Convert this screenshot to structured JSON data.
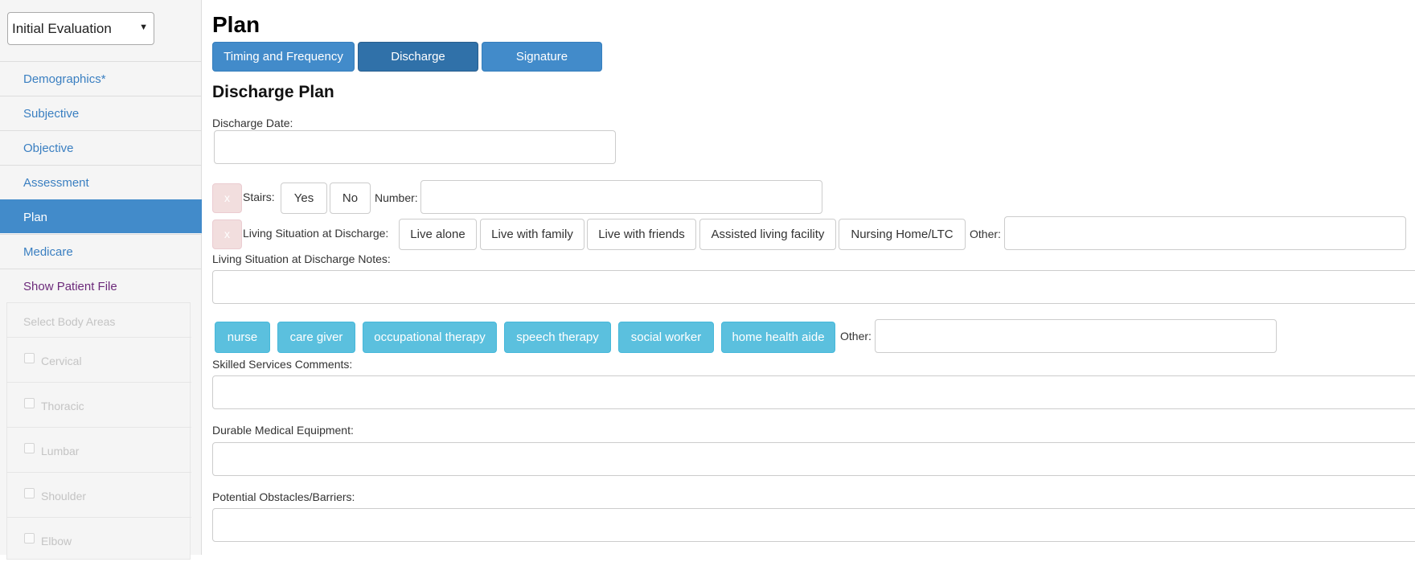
{
  "sidebar": {
    "evaluation_select": "Initial Evaluation",
    "nav": [
      {
        "label": "Demographics*"
      },
      {
        "label": "Subjective"
      },
      {
        "label": "Objective"
      },
      {
        "label": "Assessment"
      },
      {
        "label": "Plan",
        "active": true
      },
      {
        "label": "Medicare"
      },
      {
        "label": "Show Patient File"
      }
    ],
    "body_areas": {
      "header": "Select Body Areas",
      "items": [
        "Cervical",
        "Thoracic",
        "Lumbar",
        "Shoulder",
        "Elbow"
      ]
    }
  },
  "main": {
    "title": "Plan",
    "tabs": [
      {
        "label": "Timing and Frequency"
      },
      {
        "label": "Discharge",
        "active": true
      },
      {
        "label": "Signature"
      }
    ],
    "section_title": "Discharge Plan",
    "discharge_date_label": "Discharge Date:",
    "stairs": {
      "clear": "x",
      "label": "Stairs:",
      "yes": "Yes",
      "no": "No",
      "number_label": "Number:"
    },
    "living_situation": {
      "clear": "x",
      "label": "Living Situation at Discharge:",
      "options": [
        "Live alone",
        "Live with family",
        "Live with friends",
        "Assisted living facility",
        "Nursing Home/LTC"
      ],
      "other_label": "Other:"
    },
    "living_notes_label": "Living Situation at Discharge Notes:",
    "skilled_services": {
      "options": [
        "nurse",
        "care giver",
        "occupational therapy",
        "speech therapy",
        "social worker",
        "home health aide"
      ],
      "other_label": "Other:"
    },
    "skilled_comments_label": "Skilled Services Comments:",
    "dme_label": "Durable Medical Equipment:",
    "obstacles_label": "Potential Obstacles/Barriers:"
  },
  "colors": {
    "primary": "#428bca",
    "primary_active": "#3071a9",
    "info": "#5bc0de",
    "danger_light": "#f2dede",
    "link": "#3a7fc1"
  }
}
